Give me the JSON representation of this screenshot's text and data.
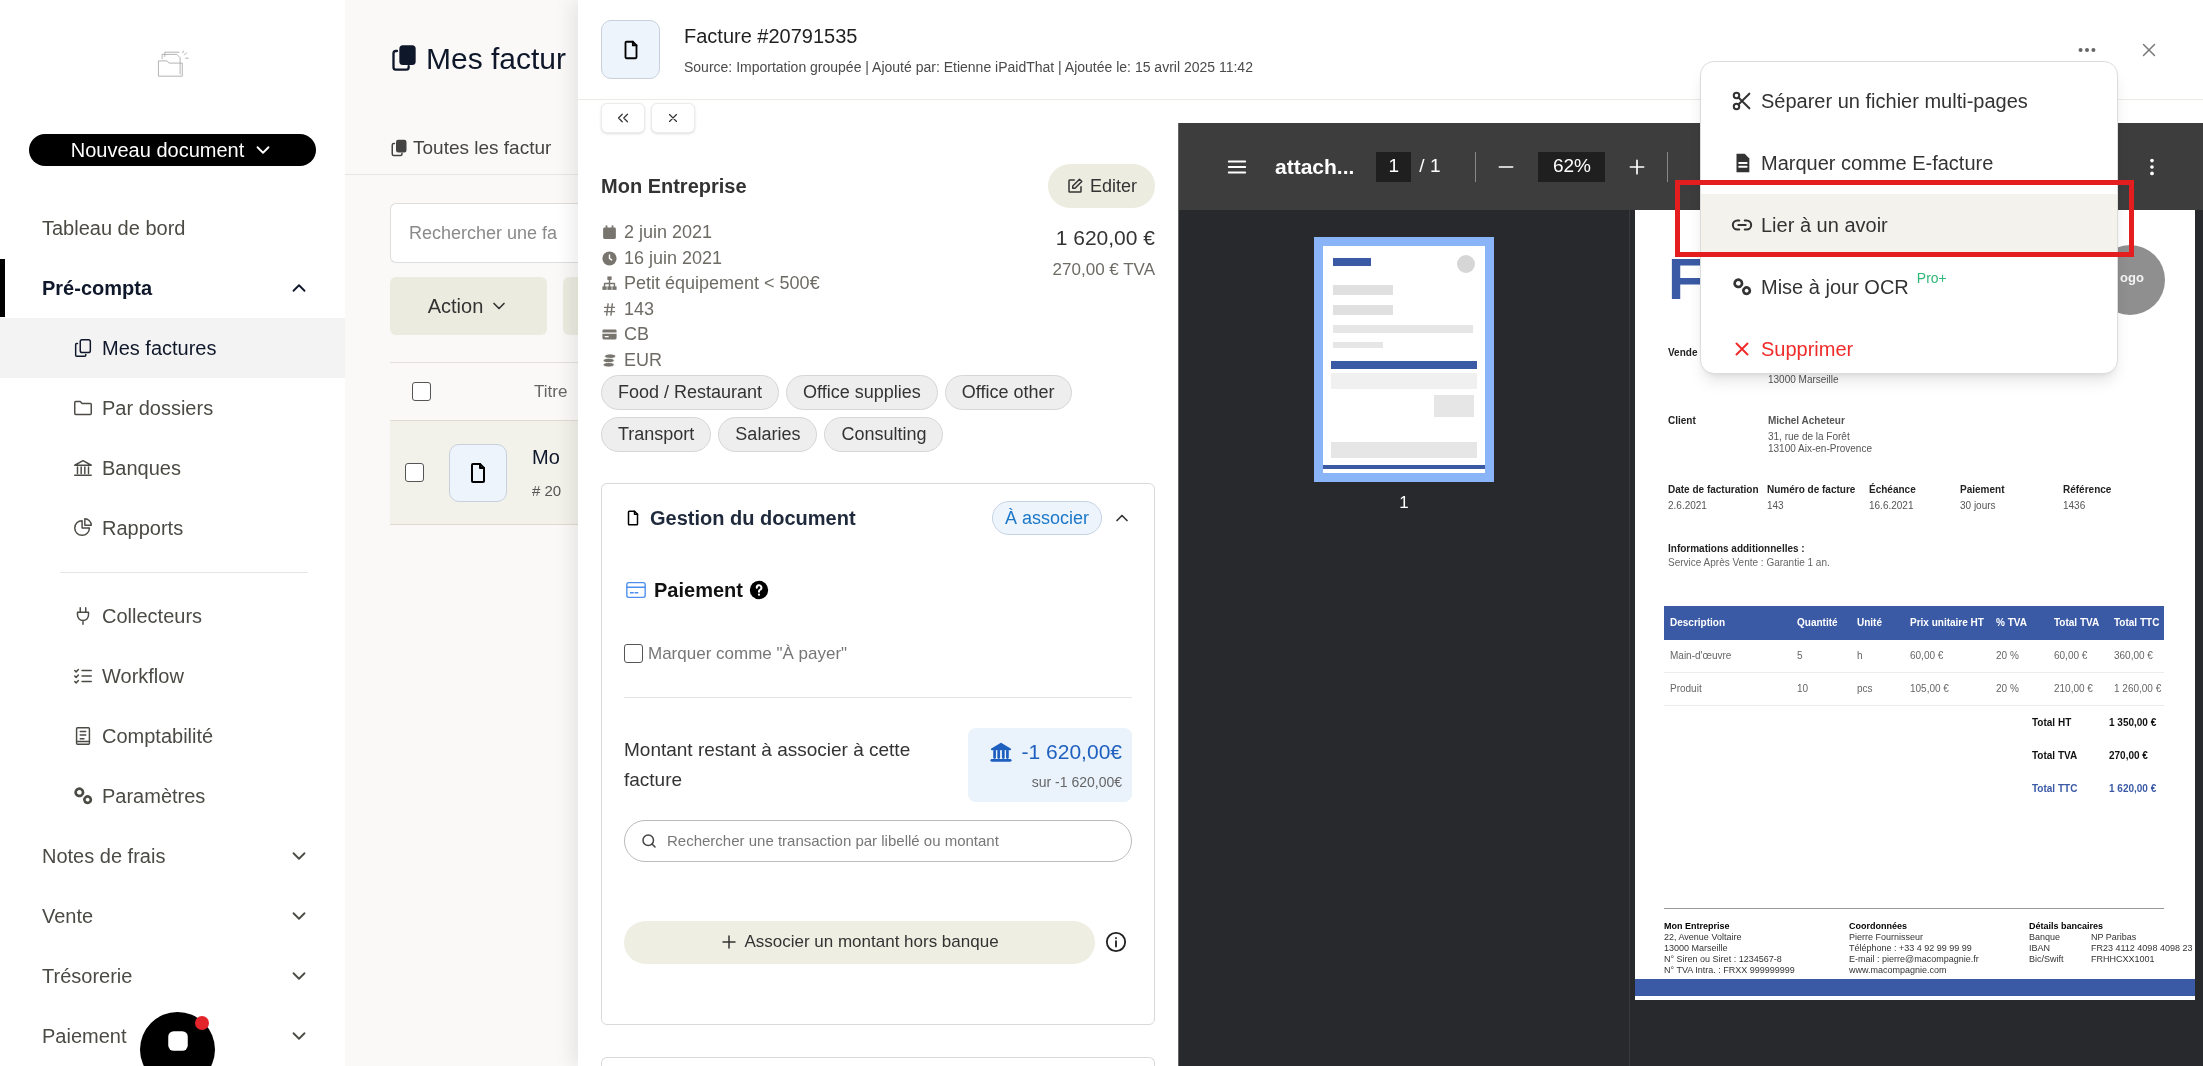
{
  "sidebar": {
    "new_document_button": "Nouveau document",
    "items": [
      {
        "label": "Tableau de bord",
        "kind": "link",
        "selected": false
      },
      {
        "label": "Pré-compta",
        "kind": "section",
        "selected": true,
        "expanded": true,
        "children": [
          {
            "label": "Mes factures",
            "selected": true,
            "divider_before": false
          },
          {
            "label": "Par dossiers",
            "selected": false,
            "divider_before": false
          },
          {
            "label": "Banques",
            "selected": false,
            "divider_before": false
          },
          {
            "label": "Rapports",
            "selected": false,
            "divider_before": false
          },
          {
            "label": "Collecteurs",
            "selected": false,
            "divider_before": true
          },
          {
            "label": "Workflow",
            "selected": false,
            "divider_before": false
          },
          {
            "label": "Comptabilité",
            "selected": false,
            "divider_before": false
          },
          {
            "label": "Paramètres",
            "selected": false,
            "divider_before": false
          }
        ]
      },
      {
        "label": "Notes de frais",
        "kind": "section",
        "selected": false,
        "expanded": false
      },
      {
        "label": "Vente",
        "kind": "section",
        "selected": false,
        "expanded": false
      },
      {
        "label": "Trésorerie",
        "kind": "section",
        "selected": false,
        "expanded": false
      },
      {
        "label": "Paiement",
        "kind": "section",
        "selected": false,
        "expanded": false
      }
    ]
  },
  "chat": {
    "unread": true
  },
  "list_page": {
    "title": "Mes factur",
    "tab": "Toutes les factur",
    "search": {
      "placeholder": "Rechercher une fa"
    },
    "action_button": "Action",
    "table": {
      "select_all": {
        "checked": false
      },
      "columns": [
        "Titre"
      ],
      "rows": [
        {
          "checked": false,
          "title": "Mo",
          "number": "# 20"
        }
      ]
    }
  },
  "document_panel": {
    "title": "Facture #20791535",
    "source": "Source: Importation groupée | Ajouté par: Etienne iPaidThat | Ajoutée le: 15 avril 2025 11:42",
    "company": "Mon Entreprise",
    "edit_button": "Editer",
    "details": [
      "2 juin 2021",
      "16 juin 2021",
      "Petit équipement < 500€",
      "143",
      "CB",
      "EUR"
    ],
    "amount": "1 620,00 €",
    "vat": "270,00 € TVA",
    "tags": [
      "Food / Restaurant",
      "Office supplies",
      "Office other",
      "Transport",
      "Salaries",
      "Consulting"
    ],
    "management": {
      "title": "Gestion du document",
      "status": "À associer",
      "expanded": true,
      "payment_title": "Paiement",
      "to_pay": {
        "label": "Marquer comme \"À payer\"",
        "checked": false
      },
      "remaining_label": "Montant restant à associer à cette facture",
      "remaining_amount": "-1 620,00€",
      "remaining_total": "sur -1 620,00€",
      "search": {
        "placeholder": "Rechercher une transaction par libellé ou montant"
      },
      "add_button": "Associer un montant hors banque"
    }
  },
  "pdf_viewer": {
    "filename": "attach...",
    "page": "1",
    "page_count": "/ 1",
    "zoom": "62%",
    "thumbnails": [
      {
        "label": "1",
        "selected": true
      }
    ],
    "document": {
      "title": "F",
      "logo": "ogo",
      "vendor_label": "Vende",
      "vendor_lines": [
        "13000 Marseille"
      ],
      "client_label": "Client",
      "client_lines": [
        "Michel Acheteur",
        "31, rue de la Forêt",
        "13100 Aix-en-Provence"
      ],
      "meta": [
        {
          "label": "Date de facturation",
          "value": "2.6.2021"
        },
        {
          "label": "Numéro de facture",
          "value": "143"
        },
        {
          "label": "Échéance",
          "value": "16.6.2021"
        },
        {
          "label": "Paiement",
          "value": "30 jours"
        },
        {
          "label": "Référence",
          "value": "1436"
        }
      ],
      "info_title": "Informations additionnelles :",
      "info_text": "Service Après Vente : Garantie 1 an.",
      "table": {
        "columns": [
          "Description",
          "Quantité",
          "Unité",
          "Prix unitaire HT",
          "% TVA",
          "Total TVA",
          "Total TTC"
        ],
        "rows": [
          [
            "Main-d'œuvre",
            "5",
            "h",
            "60,00 €",
            "20 %",
            "60,00 €",
            "360,00 €"
          ],
          [
            "Produit",
            "10",
            "pcs",
            "105,00 €",
            "20 %",
            "210,00 €",
            "1 260,00 €"
          ]
        ]
      },
      "totals": [
        {
          "label": "Total HT",
          "value": "1 350,00 €",
          "kind": "plain"
        },
        {
          "label": "Total TVA",
          "value": "270,00 €",
          "kind": "plain"
        },
        {
          "label": "Total TTC",
          "value": "1 620,00 €",
          "kind": "grand"
        }
      ],
      "footer": [
        {
          "title": "Mon Entreprise",
          "kind": "lines",
          "lines": [
            "22, Avenue Voltaire",
            "13000 Marseille",
            "N° Siren ou Siret : 1234567-8",
            "N° TVA Intra. : FRXX 999999999"
          ]
        },
        {
          "title": "Coordonnées",
          "kind": "lines",
          "lines": [
            "Pierre Fournisseur",
            "Téléphone : +33 4 92 99 99 99",
            "E-mail : pierre@macompagnie.fr",
            "www.macompagnie.com"
          ]
        },
        {
          "title": "Détails bancaires",
          "kind": "pairs",
          "pairs": [
            [
              "Banque",
              "NP Paribas"
            ],
            [
              "IBAN",
              "FR23 4112 4098 4098 23"
            ],
            [
              "Bic/Swift",
              "FRHHCXX1001"
            ]
          ]
        }
      ]
    }
  },
  "menu": {
    "items": [
      {
        "label": "Séparer un fichier multi-pages",
        "kind": "normal",
        "selected": false,
        "outlined": false
      },
      {
        "label": "Marquer comme E-facture",
        "kind": "normal",
        "selected": false,
        "outlined": false
      },
      {
        "label": "Lier à un avoir",
        "kind": "normal",
        "selected": true,
        "outlined": true
      },
      {
        "label": "Mise à jour OCR",
        "kind": "normal",
        "badge": "Pro+",
        "selected": false,
        "outlined": false
      },
      {
        "label": "Supprimer",
        "kind": "danger",
        "selected": false,
        "outlined": false
      }
    ]
  }
}
